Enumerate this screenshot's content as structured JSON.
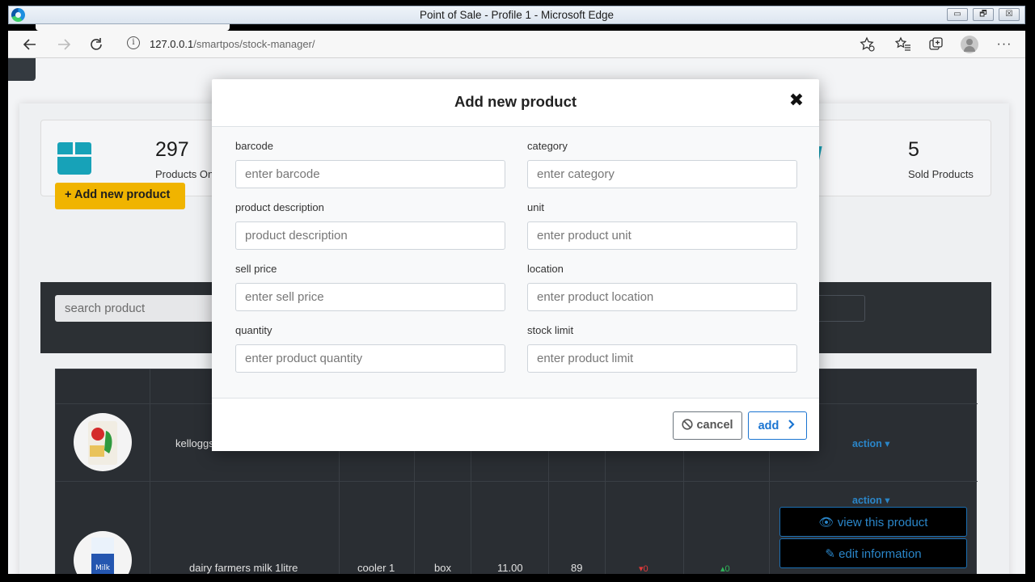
{
  "window": {
    "title": "Point of Sale - Profile 1 - Microsoft Edge",
    "controls": [
      "▭",
      "🗗",
      "☒"
    ]
  },
  "browser": {
    "url_host": "127.0.0.1",
    "url_path": "/smartpos/stock-manager/",
    "icons": [
      "back-icon",
      "forward-icon",
      "refresh-icon",
      "info-icon",
      "favorite-add-icon",
      "favorites-icon",
      "collections-icon",
      "profile-icon",
      "more-icon"
    ]
  },
  "stats": {
    "products_count": "297",
    "products_label": "Products On",
    "sold_count": "5",
    "sold_label": "Sold Products"
  },
  "buttons": {
    "add_new_product": "Add new product"
  },
  "search": {
    "placeholder": "search product"
  },
  "table": {
    "rows": [
      {
        "name": "kelloggs",
        "action": "action ▾"
      },
      {
        "name": "dairy farmers milk 1litre",
        "location": "cooler 1",
        "unit": "box",
        "price": "11.00",
        "quantity": "89",
        "down": "▾0",
        "up": "▴0",
        "action": "action ▾"
      }
    ],
    "action_menu": {
      "view": "view this product",
      "edit": "edit information"
    }
  },
  "modal": {
    "title": "Add new product",
    "close": "✖",
    "fields": [
      {
        "label": "barcode",
        "placeholder": "enter barcode"
      },
      {
        "label": "category",
        "placeholder": "enter category"
      },
      {
        "label": "product description",
        "placeholder": "product description"
      },
      {
        "label": "unit",
        "placeholder": "enter product unit"
      },
      {
        "label": "sell price",
        "placeholder": "enter sell price"
      },
      {
        "label": "location",
        "placeholder": "enter product location"
      },
      {
        "label": "quantity",
        "placeholder": "enter product quantity"
      },
      {
        "label": "stock limit",
        "placeholder": "enter product limit"
      }
    ],
    "cancel_label": "cancel",
    "add_label": "add"
  },
  "colors": {
    "accent_yellow": "#f0b400",
    "accent_teal": "#17a2b8",
    "primary_blue": "#1a74d1",
    "dark_panel": "#2c3034"
  }
}
